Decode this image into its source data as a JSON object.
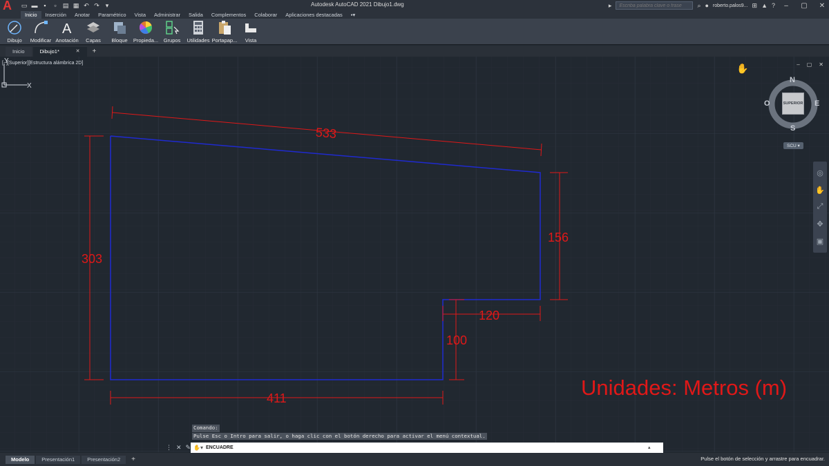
{
  "app": {
    "logo": "A",
    "window_title": "Autodesk AutoCAD 2021    Dibujo1.dwg",
    "search_placeholder": "Escriba palabra clave o frase",
    "user": "roberto.palos9...",
    "icons": [
      "new-icon",
      "open-icon",
      "save-icon",
      "save-as-icon",
      "plot-icon",
      "print-icon",
      "undo-icon",
      "redo-icon"
    ]
  },
  "ribbon_tabs": [
    "Inicio",
    "Inserción",
    "Anotar",
    "Paramétrico",
    "Vista",
    "Administrar",
    "Salida",
    "Complementos",
    "Colaborar",
    "Aplicaciones destacadas"
  ],
  "ribbon_tools": [
    {
      "label": "Dibujo",
      "icon": "draw-icon"
    },
    {
      "label": "Modificar",
      "icon": "modify-icon"
    },
    {
      "label": "Anotación",
      "icon": "annotation-icon"
    },
    {
      "label": "Capas",
      "icon": "layers-icon"
    },
    {
      "label": "Bloque",
      "icon": "block-icon"
    },
    {
      "label": "Propieda...",
      "icon": "properties-icon"
    },
    {
      "label": "Grupos",
      "icon": "groups-icon"
    },
    {
      "label": "Utilidades",
      "icon": "utilities-icon"
    },
    {
      "label": "Portapap...",
      "icon": "clipboard-icon"
    },
    {
      "label": "Vista",
      "icon": "view-icon"
    }
  ],
  "doc_tabs": {
    "start": "Inicio",
    "drawing": "Dibujo1*"
  },
  "viewport": {
    "label": "[−][Superior][Estructura alámbrica 2D]",
    "viewcube": {
      "n": "N",
      "s": "S",
      "e": "E",
      "w": "O",
      "face": "SUPERIOR"
    },
    "ucs_tag": "SCU",
    "ucs_axes": {
      "x": "X",
      "y": "Y"
    }
  },
  "drawing": {
    "polyline_color": "#1f2ad0",
    "dimension_color": "#e01818",
    "dimensions": {
      "top": "533",
      "left": "303",
      "right": "156",
      "step_width": "120",
      "step_height": "100",
      "bottom": "411"
    },
    "units_note": "Unidades: Metros (m)"
  },
  "command": {
    "history": [
      "Comando:",
      "Pulse Esc o Intro para salir, o haga clic con el botón derecho para activar el menú contextual."
    ],
    "current": "ENCUADRE"
  },
  "layout_tabs": [
    "Modelo",
    "Presentación1",
    "Presentación2"
  ],
  "status_message": "Pulse el botón de selección y arrastre para encuadrar."
}
